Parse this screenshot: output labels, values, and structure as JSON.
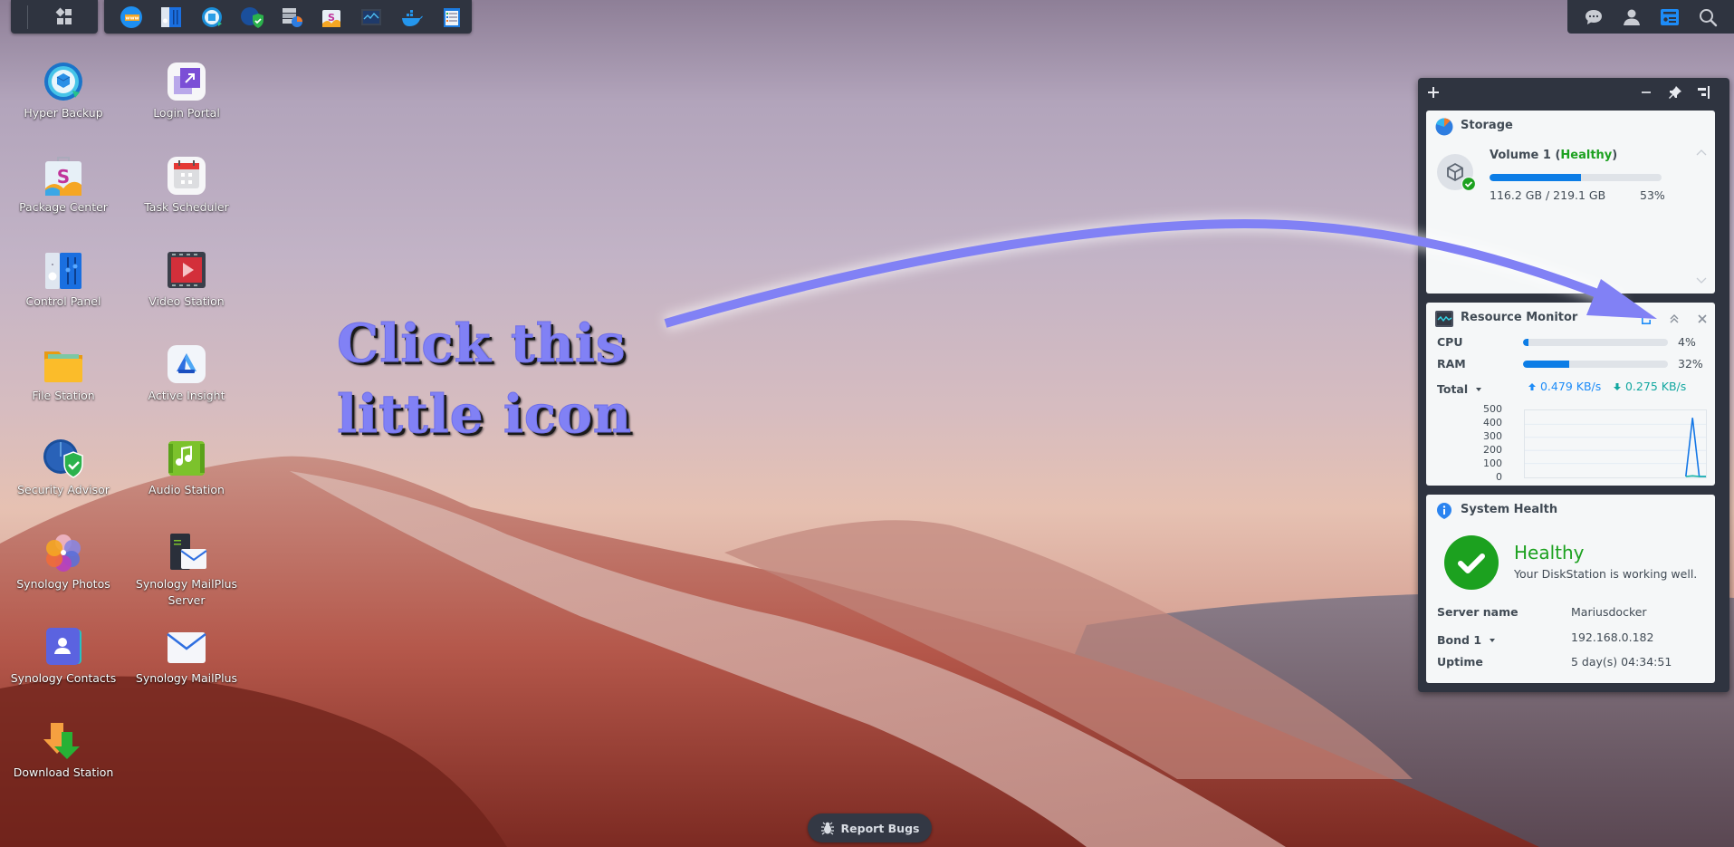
{
  "taskbar": {
    "main_menu_icon": "grid-icon",
    "pinned_apps": [
      {
        "name": "Web Station",
        "icon": "www-globe-icon"
      },
      {
        "name": "Control Panel",
        "icon": "control-panel-icon"
      },
      {
        "name": "Hyper Backup",
        "icon": "hyper-backup-icon"
      },
      {
        "name": "Security Advisor",
        "icon": "security-advisor-icon"
      },
      {
        "name": "Storage Manager",
        "icon": "storage-manager-icon"
      },
      {
        "name": "Package Center",
        "icon": "package-center-icon"
      },
      {
        "name": "Resource Monitor",
        "icon": "resource-monitor-icon"
      },
      {
        "name": "Docker",
        "icon": "docker-whale-icon"
      },
      {
        "name": "Log Center",
        "icon": "log-center-icon"
      }
    ],
    "right_icons": [
      {
        "name": "Notifications",
        "icon": "chat-bubble-icon"
      },
      {
        "name": "Options",
        "icon": "user-icon"
      },
      {
        "name": "Widgets",
        "icon": "widgets-icon"
      },
      {
        "name": "Search",
        "icon": "search-icon"
      }
    ]
  },
  "desktop": {
    "icons": [
      {
        "label": "Hyper Backup"
      },
      {
        "label": "Login Portal"
      },
      {
        "label": "Package Center"
      },
      {
        "label": "Task Scheduler"
      },
      {
        "label": "Control Panel"
      },
      {
        "label": "Video Station"
      },
      {
        "label": "File Station"
      },
      {
        "label": "Active Insight"
      },
      {
        "label": "Security Advisor"
      },
      {
        "label": "Audio Station"
      },
      {
        "label": "Synology Photos"
      },
      {
        "label": "Synology MailPlus Server"
      },
      {
        "label": "Synology Contacts"
      },
      {
        "label": "Synology MailPlus"
      },
      {
        "label": "Download Station"
      }
    ]
  },
  "annotation": {
    "line1": "Click this",
    "line2": "little icon",
    "color": "#8181f5"
  },
  "widgets": {
    "storage": {
      "title": "Storage",
      "volume_name": "Volume 1 (",
      "volume_status": "Healthy",
      "volume_close": ")",
      "used": "116.2 GB / 219.1 GB",
      "percent_label": "53%",
      "usage_fraction": 0.53
    },
    "resource_monitor": {
      "title": "Resource Monitor",
      "cpu_label": "CPU",
      "cpu_value": "4%",
      "cpu_fraction": 0.04,
      "ram_label": "RAM",
      "ram_value": "32%",
      "ram_fraction": 0.32,
      "network_label": "Total",
      "upload": "0.479 KB/s",
      "download": "0.275 KB/s",
      "chart_y_ticks": [
        "500",
        "400",
        "300",
        "200",
        "100",
        "0"
      ],
      "chart": {
        "ymax": 500,
        "upload_series": [
          0,
          0,
          0,
          0,
          0,
          0,
          0,
          0,
          0,
          0,
          0,
          0,
          0,
          0,
          0,
          0,
          0,
          0,
          0,
          0,
          0,
          0,
          0,
          0,
          0,
          450,
          0,
          0
        ],
        "download_series": [
          0,
          0,
          0,
          0,
          0,
          0,
          0,
          0,
          0,
          0,
          0,
          0,
          0,
          0,
          0,
          0,
          0,
          0,
          0,
          0,
          0,
          0,
          0,
          0,
          0,
          5,
          0,
          0
        ]
      }
    },
    "system_health": {
      "title": "System Health",
      "status": "Healthy",
      "message": "Your DiskStation is working well.",
      "rows": [
        {
          "label": "Server name",
          "value": "Mariusdocker"
        },
        {
          "label": "Bond 1",
          "value": "192.168.0.182"
        },
        {
          "label": "Uptime",
          "value": "5 day(s) 04:34:51"
        }
      ]
    }
  },
  "colors": {
    "accent_blue": "#0c7de6",
    "healthy_green": "#1ca11f",
    "download_teal": "#12a7a0"
  },
  "report_bugs": {
    "label": "Report Bugs"
  }
}
